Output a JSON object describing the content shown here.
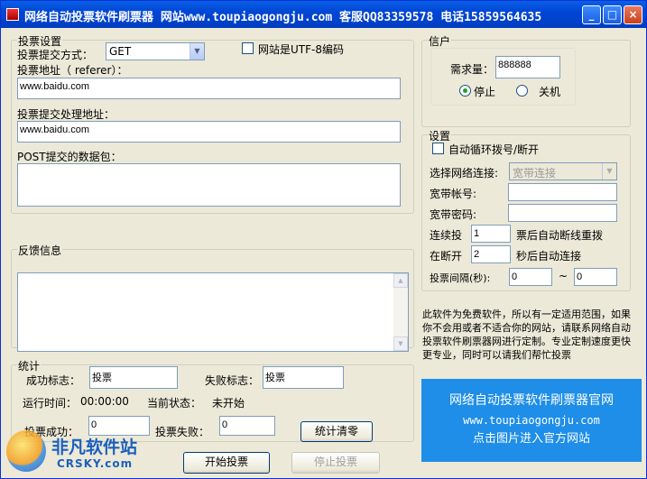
{
  "window": {
    "title": "网络自动投票软件刷票器  网站www.toupiaogongju.com 客服QQ83359578  电话15859564635",
    "min_glyph": "_",
    "max_glyph": "□",
    "close_glyph": "×"
  },
  "vote_settings": {
    "group_label": "投票设置",
    "method_label": "投票提交方式：",
    "method_value": "GET",
    "utf8_label": "网站是UTF-8编码",
    "referer_label": "投票地址（ referer）：",
    "referer_value": "www.baidu.com",
    "handler_label": "投票提交处理地址：",
    "handler_value": "www.baidu.com",
    "post_label": "POST提交的数据包："
  },
  "feedback": {
    "group_label": "反馈信息"
  },
  "stats": {
    "group_label": "统计",
    "success_flag_label": "成功标志：",
    "success_flag_value": "投票",
    "fail_flag_label": "失败标志：",
    "fail_flag_value": "投票",
    "runtime_label": "运行时间：",
    "runtime_value": "00:00:00",
    "status_label": "当前状态：",
    "status_value": "未开始",
    "vote_success_label": "投票成功：",
    "vote_success_value": "0",
    "vote_fail_label": "投票失败：",
    "vote_fail_value": "0",
    "clear_button": "统计清零"
  },
  "actions": {
    "start_button": "开始投票",
    "stop_button": "停止投票"
  },
  "credit": {
    "group_label": "信户",
    "demand_label": "需求量：",
    "demand_value": "888888",
    "stop_label": "停止",
    "shutdown_label": "关机"
  },
  "settings": {
    "group_label": "设置",
    "auto_dial_label": "自动循环拨号/断开",
    "connection_label": "选择网络连接:",
    "connection_value": "宽带连接",
    "account_label": "宽带帐号:",
    "password_label": "宽带密码:",
    "continue_label": "连续投",
    "continue_value": "1",
    "continue_suffix": "票后自动断线重拨",
    "disconnect_label": "在断开",
    "disconnect_value": "2",
    "disconnect_suffix": "秒后自动连接",
    "interval_label": "投票间隔(秒):",
    "interval_from": "0",
    "interval_tilde": "~",
    "interval_to": "0"
  },
  "note": {
    "text": "此软件为免费软件，所以有一定适用范围，如果你不会用或者不适合你的网站，请联系网络自动投票软件刷票器网进行定制。专业定制速度更快更专业，同时可以请我们帮忙投票"
  },
  "banner": {
    "line1": "网络自动投票软件刷票器官网",
    "line2": "www.toupiaogongju.com",
    "line3": "点击图片进入官方网站"
  },
  "watermark": {
    "line1": "非凡软件站",
    "line2": "CRSKY.com"
  }
}
